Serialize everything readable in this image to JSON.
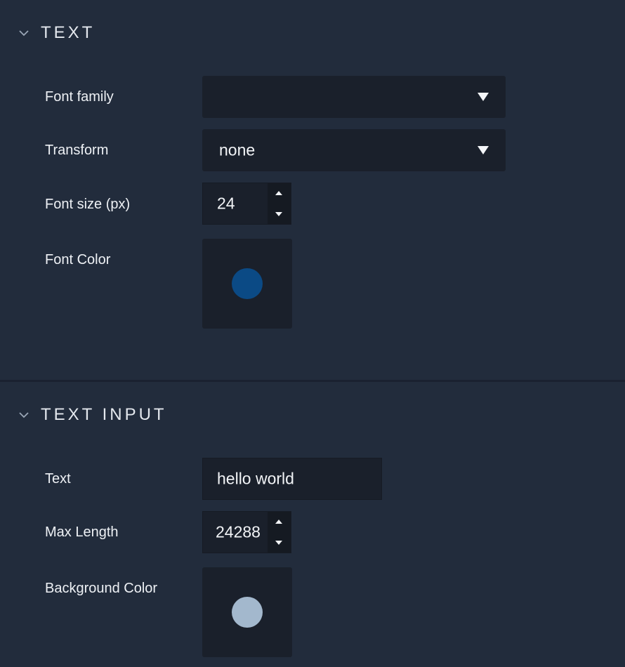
{
  "text_section": {
    "title": "TEXT",
    "chevron_icon": "chevron-down-icon",
    "font_family": {
      "label": "Font family",
      "value": "",
      "arrow_icon": "dropdown-arrow-icon"
    },
    "transform": {
      "label": "Transform",
      "value": "none",
      "arrow_icon": "dropdown-arrow-icon"
    },
    "font_size": {
      "label": "Font size (px)",
      "value": "24"
    },
    "font_color": {
      "label": "Font Color",
      "color": "#0b4a85"
    }
  },
  "text_input_section": {
    "title": "TEXT INPUT",
    "chevron_icon": "chevron-down-icon",
    "text": {
      "label": "Text",
      "value": "hello world"
    },
    "max_length": {
      "label": "Max Length",
      "value": "24288"
    },
    "background_color": {
      "label": "Background Color",
      "color": "#a3b8cd"
    }
  },
  "colors": {
    "panel_bg": "#222c3c",
    "field_bg": "#1a202b"
  }
}
